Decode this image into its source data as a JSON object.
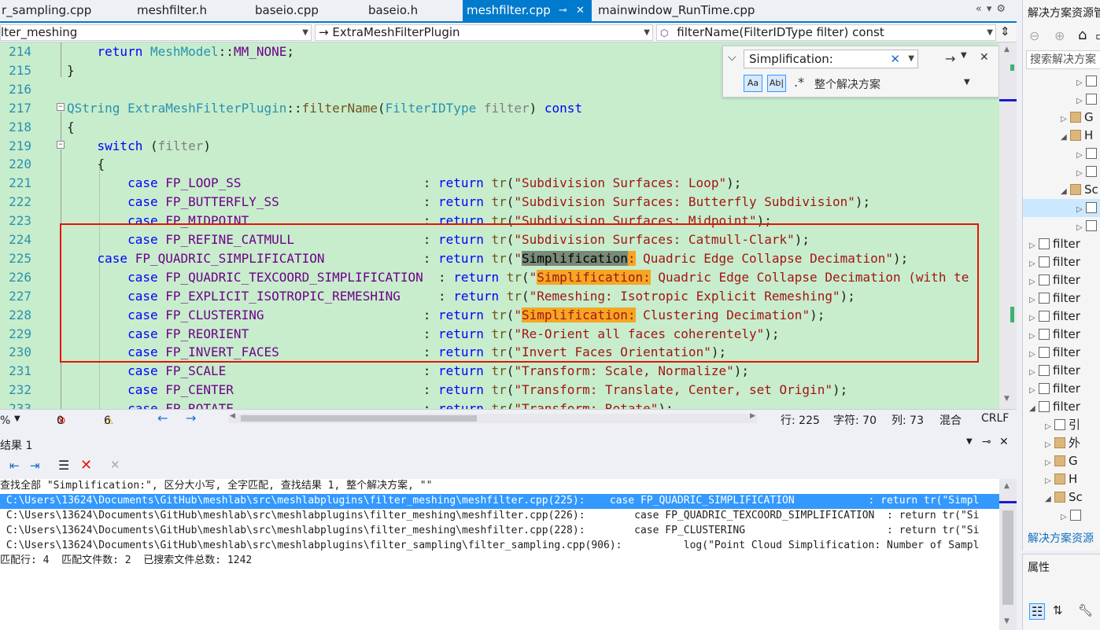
{
  "tabs": [
    {
      "label": "r_sampling.cpp",
      "active": false
    },
    {
      "label": "meshfilter.h",
      "active": false
    },
    {
      "label": "baseio.cpp",
      "active": false
    },
    {
      "label": "baseio.h",
      "active": false
    },
    {
      "label": "meshfilter.cpp",
      "active": true
    },
    {
      "label": "mainwindow_RunTime.cpp",
      "active": false
    }
  ],
  "nav": {
    "project": "lter_meshing",
    "class": "ExtraMeshFilterPlugin",
    "member": "filterName(FilterIDType filter) const"
  },
  "find": {
    "query": "Simplification:",
    "scope": "整个解决方案",
    "match_case": "Aa",
    "whole_word": "Ab|"
  },
  "line_numbers": [
    "214",
    "215",
    "216",
    "217",
    "218",
    "219",
    "220",
    "221",
    "222",
    "223",
    "224",
    "225",
    "226",
    "227",
    "228",
    "229",
    "230",
    "231",
    "232",
    "233"
  ],
  "status": {
    "zoom": "%",
    "errors": "0",
    "warnings": "6",
    "line": "行: 225",
    "char": "字符: 70",
    "col": "列: 73",
    "mixed": "混合",
    "eol": "CRLF"
  },
  "results": {
    "title": "结果 1",
    "summary": "查找全部 \"Simplification:\", 区分大小写, 全字匹配, 查找结果 1, 整个解决方案, \"\"",
    "lines": [
      " C:\\Users\\13624\\Documents\\GitHub\\meshlab\\src\\meshlabplugins\\filter_meshing\\meshfilter.cpp(225):    case FP_QUADRIC_SIMPLIFICATION            : return tr(\"Simpl",
      " C:\\Users\\13624\\Documents\\GitHub\\meshlab\\src\\meshlabplugins\\filter_meshing\\meshfilter.cpp(226):        case FP_QUADRIC_TEXCOORD_SIMPLIFICATION  : return tr(\"Si",
      " C:\\Users\\13624\\Documents\\GitHub\\meshlab\\src\\meshlabplugins\\filter_meshing\\meshfilter.cpp(228):        case FP_CLUSTERING                       : return tr(\"Si",
      " C:\\Users\\13624\\Documents\\GitHub\\meshlab\\src\\meshlabplugins\\filter_sampling\\filter_sampling.cpp(906):          log(\"Point Cloud Simplification: Number of Sampl"
    ],
    "footer": "匹配行: 4  匹配文件数: 2  已搜索文件总数: 1242"
  },
  "solution": {
    "title": "解决方案资源管",
    "search": "搜索解决方案",
    "items": [
      {
        "label": "",
        "indent": 3,
        "twisty": "▷",
        "icon": "file"
      },
      {
        "label": "",
        "indent": 3,
        "twisty": "▷",
        "icon": "file"
      },
      {
        "label": "G",
        "indent": 2,
        "twisty": "▷",
        "icon": "folder"
      },
      {
        "label": "H",
        "indent": 2,
        "twisty": "◢",
        "icon": "folder"
      },
      {
        "label": "",
        "indent": 3,
        "twisty": "▷",
        "icon": "file"
      },
      {
        "label": "",
        "indent": 3,
        "twisty": "▷",
        "icon": "file"
      },
      {
        "label": "Sc",
        "indent": 2,
        "twisty": "◢",
        "icon": "folder"
      },
      {
        "label": "",
        "indent": 3,
        "twisty": "▷",
        "icon": "file"
      },
      {
        "label": "",
        "indent": 3,
        "twisty": "▷",
        "icon": "file"
      },
      {
        "label": "filter",
        "indent": 0,
        "twisty": "▷",
        "icon": "proj"
      },
      {
        "label": "filter",
        "indent": 0,
        "twisty": "▷",
        "icon": "proj"
      },
      {
        "label": "filter",
        "indent": 0,
        "twisty": "▷",
        "icon": "proj"
      },
      {
        "label": "filter",
        "indent": 0,
        "twisty": "▷",
        "icon": "proj"
      },
      {
        "label": "filter",
        "indent": 0,
        "twisty": "▷",
        "icon": "proj"
      },
      {
        "label": "filter",
        "indent": 0,
        "twisty": "▷",
        "icon": "proj"
      },
      {
        "label": "filter",
        "indent": 0,
        "twisty": "▷",
        "icon": "proj"
      },
      {
        "label": "filter",
        "indent": 0,
        "twisty": "▷",
        "icon": "proj"
      },
      {
        "label": "filter",
        "indent": 0,
        "twisty": "▷",
        "icon": "proj"
      },
      {
        "label": "filter",
        "indent": 0,
        "twisty": "◢",
        "icon": "proj"
      },
      {
        "label": "引",
        "indent": 1,
        "twisty": "▷",
        "icon": "file"
      },
      {
        "label": "外",
        "indent": 1,
        "twisty": "▷",
        "icon": "folder"
      },
      {
        "label": "G",
        "indent": 1,
        "twisty": "▷",
        "icon": "folder"
      },
      {
        "label": "H",
        "indent": 1,
        "twisty": "▷",
        "icon": "folder"
      },
      {
        "label": "Sc",
        "indent": 1,
        "twisty": "◢",
        "icon": "folder"
      },
      {
        "label": "",
        "indent": 2,
        "twisty": "▷",
        "icon": "file"
      }
    ],
    "footer": "解决方案资源"
  },
  "properties": {
    "title": "属性"
  },
  "colors": {
    "accent": "#007acc",
    "editor_bg": "#c7edcc",
    "highlight": "#f5a623",
    "redbox": "#e51400",
    "selection": "#3399ff"
  }
}
